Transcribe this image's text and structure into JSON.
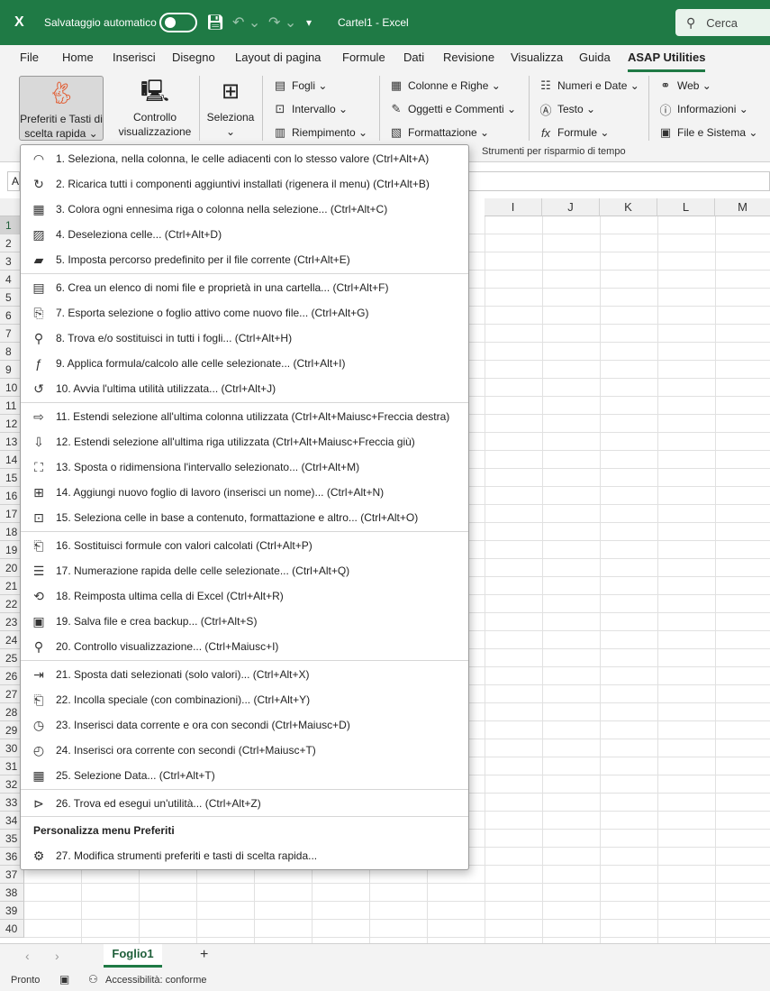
{
  "titlebar": {
    "app_logo": "X",
    "autosave_label": "Salvataggio automatico",
    "document_title": "Cartel1  -  Excel",
    "search_placeholder": "Cerca",
    "bg_color": "#1f7a45"
  },
  "tabs": [
    "File",
    "Home",
    "Inserisci",
    "Disegno",
    "Layout di pagina",
    "Formule",
    "Dati",
    "Revisione",
    "Visualizza",
    "Guida",
    "ASAP Utilities"
  ],
  "active_tab": "ASAP Utilities",
  "ribbon": {
    "favorites_line1": "Preferiti e Tasti di",
    "favorites_line2": "scelta rapida ⌄",
    "control_line1": "Controllo",
    "control_line2": "visualizzazione",
    "select_line1": "Seleziona",
    "select_line2": "⌄",
    "col2": [
      "Fogli ⌄",
      "Intervallo ⌄",
      "Riempimento ⌄"
    ],
    "col3": [
      "Colonne e Righe ⌄",
      "Oggetti e Commenti ⌄",
      "Formattazione ⌄"
    ],
    "col4": [
      "Numeri e Date ⌄",
      "Testo ⌄",
      "Formule ⌄"
    ],
    "col5": [
      "Web ⌄",
      "Informazioni ⌄",
      "File e Sistema ⌄"
    ],
    "group_label": "Strumenti per risparmio di tempo"
  },
  "formula_bar": {
    "name_box": "A"
  },
  "columns": [
    "I",
    "J",
    "K",
    "L",
    "M"
  ],
  "rows": [
    "1",
    "2",
    "3",
    "4",
    "5",
    "6",
    "7",
    "8",
    "9",
    "10",
    "11",
    "12",
    "13",
    "14",
    "15",
    "16",
    "17",
    "18",
    "19",
    "20",
    "21",
    "22",
    "23",
    "24",
    "25",
    "26",
    "27",
    "28",
    "29",
    "30",
    "31",
    "32",
    "33",
    "34",
    "35",
    "36",
    "37",
    "38",
    "39",
    "40"
  ],
  "menu": {
    "items": [
      {
        "icon": "curve-icon",
        "glyph": "◠",
        "label": "1. Seleziona, nella colonna, le celle adiacenti con lo stesso valore (Ctrl+Alt+A)"
      },
      {
        "icon": "refresh-icon",
        "glyph": "↻",
        "label": "2. Ricarica tutti i componenti aggiuntivi installati (rigenera il menu) (Ctrl+Alt+B)"
      },
      {
        "icon": "table-color-icon",
        "glyph": "▦",
        "label": "3. Colora ogni ennesima riga o colonna nella selezione... (Ctrl+Alt+C)"
      },
      {
        "icon": "deselect-icon",
        "glyph": "▨",
        "label": "4. Deseleziona celle... (Ctrl+Alt+D)"
      },
      {
        "icon": "folder-icon",
        "glyph": "▰",
        "label": "5. Imposta percorso predefinito per il file corrente (Ctrl+Alt+E)"
      },
      {
        "icon": "file-list-icon",
        "glyph": "▤",
        "label": "6. Crea un elenco di nomi file e proprietà in una cartella... (Ctrl+Alt+F)"
      },
      {
        "icon": "export-icon",
        "glyph": "⎘",
        "label": "7. Esporta selezione o foglio attivo come nuovo file... (Ctrl+Alt+G)"
      },
      {
        "icon": "search-icon",
        "glyph": "⚲",
        "label": "8. Trova e/o sostituisci in tutti i fogli... (Ctrl+Alt+H)"
      },
      {
        "icon": "fx-icon",
        "glyph": "ƒ",
        "label": "9. Applica formula/calcolo alle celle selezionate... (Ctrl+Alt+I)"
      },
      {
        "icon": "repeat-icon",
        "glyph": "↺",
        "label": "10. Avvia l'ultima utilità utilizzata... (Ctrl+Alt+J)"
      },
      {
        "icon": "arrow-right-icon",
        "glyph": "⇨",
        "label": "11. Estendi selezione all'ultima colonna utilizzata (Ctrl+Alt+Maiusc+Freccia destra)"
      },
      {
        "icon": "arrow-down-icon",
        "glyph": "⇩",
        "label": "12. Estendi selezione all'ultima riga utilizzata (Ctrl+Alt+Maiusc+Freccia giù)"
      },
      {
        "icon": "resize-icon",
        "glyph": "⛶",
        "label": "13. Sposta o ridimensiona l'intervallo selezionato... (Ctrl+Alt+M)"
      },
      {
        "icon": "new-sheet-icon",
        "glyph": "⊞",
        "label": "14. Aggiungi nuovo foglio di lavoro (inserisci un nome)... (Ctrl+Alt+N)"
      },
      {
        "icon": "select-content-icon",
        "glyph": "⊡",
        "label": "15. Seleziona celle in base a contenuto, formattazione e altro... (Ctrl+Alt+O)"
      },
      {
        "icon": "paste-values-icon",
        "glyph": "⎗",
        "label": "16. Sostituisci formule con valori calcolati (Ctrl+Alt+P)"
      },
      {
        "icon": "numbering-icon",
        "glyph": "☰",
        "label": "17. Numerazione rapida delle celle selezionate... (Ctrl+Alt+Q)"
      },
      {
        "icon": "reset-cell-icon",
        "glyph": "⟲",
        "label": "18. Reimposta ultima cella di Excel (Ctrl+Alt+R)"
      },
      {
        "icon": "save-backup-icon",
        "glyph": "▣",
        "label": "19. Salva file e crea backup... (Ctrl+Alt+S)"
      },
      {
        "icon": "zoom-icon",
        "glyph": "⚲",
        "label": "20. Controllo visualizzazione... (Ctrl+Maiusc+I)"
      },
      {
        "icon": "move-data-icon",
        "glyph": "⇥",
        "label": "21. Sposta dati selezionati (solo valori)... (Ctrl+Alt+X)"
      },
      {
        "icon": "paste-special-icon",
        "glyph": "⎗",
        "label": "22. Incolla speciale (con combinazioni)... (Ctrl+Alt+Y)"
      },
      {
        "icon": "calendar-clock-icon",
        "glyph": "◷",
        "label": "23. Inserisci data corrente e ora con secondi (Ctrl+Maiusc+D)"
      },
      {
        "icon": "clock-icon",
        "glyph": "◴",
        "label": "24. Inserisci ora corrente con secondi (Ctrl+Maiusc+T)"
      },
      {
        "icon": "calendar-icon",
        "glyph": "▦",
        "label": "25. Selezione Data... (Ctrl+Alt+T)"
      },
      {
        "icon": "run-utility-icon",
        "glyph": "⊳",
        "label": "26. Trova ed esegui un'utilità... (Ctrl+Alt+Z)"
      }
    ],
    "section_header": "Personalizza menu Preferiti",
    "last_item": {
      "icon": "settings-icon",
      "glyph": "⚙",
      "label": "27. Modifica strumenti preferiti e tasti di scelta rapida..."
    }
  },
  "sheets": {
    "active": "Foglio1",
    "add": "+"
  },
  "status": {
    "ready": "Pronto",
    "accessibility": "Accessibilità: conforme"
  }
}
